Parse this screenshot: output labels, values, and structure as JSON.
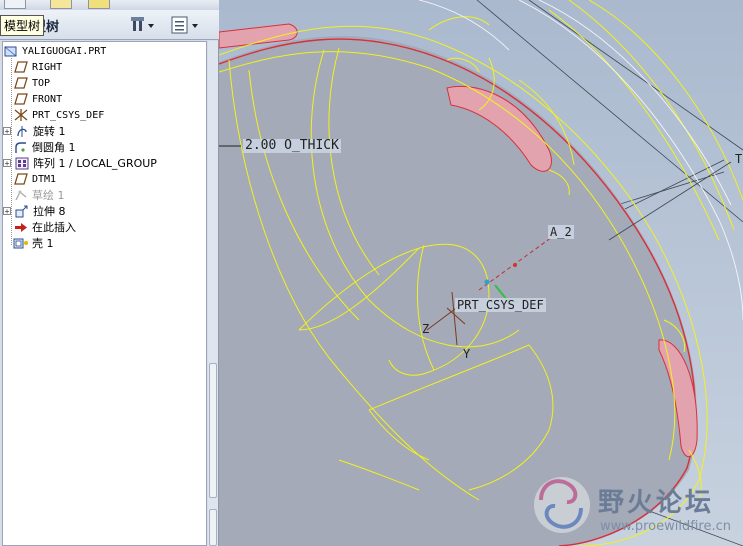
{
  "model_tree": {
    "title": "模型树",
    "tooltip": "模型树",
    "items": [
      {
        "label": "YALIGUOGAI.PRT",
        "icon": "part-icon",
        "expandable": false,
        "dim": false
      },
      {
        "label": "RIGHT",
        "icon": "datum-plane-icon",
        "expandable": false,
        "dim": false
      },
      {
        "label": "TOP",
        "icon": "datum-plane-icon",
        "expandable": false,
        "dim": false
      },
      {
        "label": "FRONT",
        "icon": "datum-plane-icon",
        "expandable": false,
        "dim": false
      },
      {
        "label": "PRT_CSYS_DEF",
        "icon": "csys-icon",
        "expandable": false,
        "dim": false
      },
      {
        "label": "旋转 1",
        "icon": "revolve-icon",
        "expandable": true,
        "dim": false
      },
      {
        "label": "倒圆角 1",
        "icon": "round-icon",
        "expandable": false,
        "dim": false
      },
      {
        "label": "阵列 1 / LOCAL_GROUP",
        "icon": "pattern-icon",
        "expandable": true,
        "dim": false
      },
      {
        "label": "DTM1",
        "icon": "datum-plane-icon",
        "expandable": false,
        "dim": false
      },
      {
        "label": "草绘 1",
        "icon": "sketch-icon",
        "expandable": false,
        "dim": true
      },
      {
        "label": "拉伸 8",
        "icon": "extrude-icon",
        "expandable": true,
        "dim": false
      },
      {
        "label": "在此插入",
        "icon": "insert-here-arrow-icon",
        "expandable": false,
        "dim": false
      },
      {
        "label": "壳 1",
        "icon": "shell-icon",
        "expandable": false,
        "dim": false
      }
    ]
  },
  "viewport": {
    "dimension_label": "2.00 O_THICK",
    "axis_label": "A_2",
    "csys_label": "PRT_CSYS_DEF",
    "csys_z": "Z",
    "csys_y": "Y",
    "edge_label": "T"
  },
  "watermark": {
    "text": "野火论坛",
    "url": "www.proewildfire.cn"
  },
  "colors": {
    "panel_bg": "#d6dde8",
    "viewport_bg": "#b4c2d4",
    "part_surface": "#a3a9b6",
    "edge_yellow": "#f2f21c",
    "edge_red": "#d8303a",
    "highlight_pink": "#e5a0ab"
  }
}
